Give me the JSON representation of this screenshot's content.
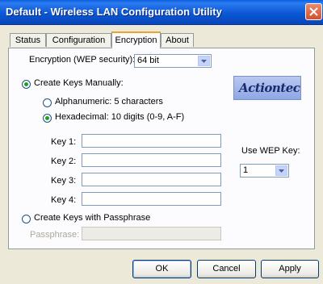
{
  "window": {
    "title": "Default - Wireless LAN Configuration Utility"
  },
  "tabs": [
    {
      "label": "Status"
    },
    {
      "label": "Configuration"
    },
    {
      "label": "Encryption",
      "active": true
    },
    {
      "label": "About"
    }
  ],
  "encryption": {
    "label": "Encryption (WEP security):",
    "value": "64 bit"
  },
  "manual": {
    "label": "Create Keys Manually:",
    "alphanumeric_label": "Alphanumeric: 5 characters",
    "hexadecimal_label": "Hexadecimal: 10 digits (0-9, A-F)"
  },
  "keys": [
    {
      "label": "Key 1:",
      "value": ""
    },
    {
      "label": "Key 2:",
      "value": ""
    },
    {
      "label": "Key 3:",
      "value": ""
    },
    {
      "label": "Key 4:",
      "value": ""
    }
  ],
  "use_wep_key": {
    "label": "Use WEP Key:",
    "value": "1"
  },
  "passphrase": {
    "radio_label": "Create Keys with Passphrase",
    "label": "Passphrase:",
    "value": ""
  },
  "logo": {
    "text": "Actiontec"
  },
  "buttons": {
    "ok": "OK",
    "cancel": "Cancel",
    "apply": "Apply"
  },
  "colors": {
    "title_bar": "#0b58d6",
    "face": "#ece9d8",
    "tab_highlight": "#e8a52b"
  }
}
